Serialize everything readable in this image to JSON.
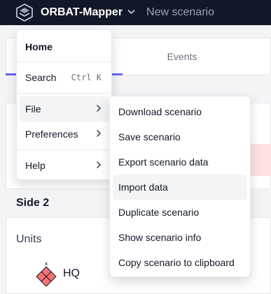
{
  "header": {
    "app_title": "ORBAT-Mapper",
    "scenario_name": "New scenario",
    "logo_icon": "orbat-logo-icon",
    "dropdown_icon": "chevron-down-icon"
  },
  "tabs": {
    "events_label": "Events",
    "accent_color": "#6366f1"
  },
  "side": {
    "title": "Side 2",
    "units_label": "Units",
    "units": [
      {
        "name": "HQ",
        "icon": "hostile-hq-unit-symbol"
      }
    ]
  },
  "main_menu": {
    "items": [
      {
        "label": "Home"
      },
      {
        "label": "Search",
        "shortcut": "Ctrl K"
      },
      {
        "label": "File",
        "has_submenu": true
      },
      {
        "label": "Preferences",
        "has_submenu": true
      },
      {
        "label": "Help",
        "has_submenu": true
      }
    ]
  },
  "file_submenu": {
    "items": [
      {
        "label": "Download scenario"
      },
      {
        "label": "Save scenario"
      },
      {
        "label": "Export scenario data"
      },
      {
        "label": "Import data"
      },
      {
        "label": "Duplicate scenario"
      },
      {
        "label": "Show scenario info"
      },
      {
        "label": "Copy scenario to clipboard"
      }
    ]
  }
}
